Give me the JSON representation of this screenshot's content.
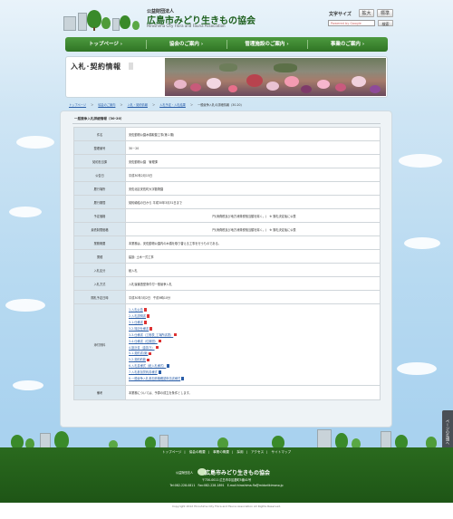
{
  "header": {
    "org_small": "公益財団法人",
    "org_name": "広島市みどり生きもの協会",
    "org_en": "Hiroshima City Flora and Fauna Association",
    "text_size_label": "文字サイズ",
    "text_size_large": "拡大",
    "text_size_standard": "標準",
    "search_placeholder": "Powered by Google",
    "search_button": "検索"
  },
  "nav": {
    "items": [
      {
        "label": "トップページ ›"
      },
      {
        "label": "協会のご案内 ›"
      },
      {
        "label": "管理施設のご案内 ›"
      },
      {
        "label": "事業のご案内 ›"
      }
    ]
  },
  "page": {
    "title": "入札･契約情報"
  },
  "breadcrumb": {
    "items": [
      "トップページ",
      "＞",
      "協会のご案内",
      "＞",
      "入札・契約情報",
      "＞",
      "入札予定・入札結果",
      "＞",
      "一般競争入札の詳細情報（30-20）"
    ]
  },
  "section": {
    "title": "一般競争入札詳細情報（30-20）"
  },
  "spec": {
    "rows": [
      {
        "label": "件名",
        "value": "安佐動物公園木橋取替工事(第１期)"
      },
      {
        "label": "整理番号",
        "value": "30－20"
      },
      {
        "label": "契約担当課",
        "value": "安佐動物公園　管理課"
      },
      {
        "label": "公告日",
        "value": "平成30年2月15日"
      },
      {
        "label": "履行場所",
        "value": "安佐北区安佐町大字動物園"
      },
      {
        "label": "履行期間",
        "value": "契約締結の日から 平成30年3月31日まで"
      },
      {
        "label": "予定価格",
        "value": "円(消費税及び地方消費税相当額を除く。)　※ 落札決定後に公表"
      },
      {
        "label": "最低制限価格",
        "value": "円(消費税及び地方消費税相当額を除く。)　※ 落札決定後に公表"
      },
      {
        "label": "業務概要",
        "value": "本業務は、安佐動物公園内の木橋を取り替える工事を行うものである。"
      },
      {
        "label": "業種",
        "value": "建設: 土木一式工事"
      },
      {
        "label": "入札区分",
        "value": "紙入札"
      },
      {
        "label": "入札方式",
        "value": "入札後審査型条件付一般競争入札"
      },
      {
        "label": "開札予定日時",
        "value": "平成30年3月2日　午前9時10分"
      }
    ],
    "attach_label": "添付資料",
    "attachments": [
      {
        "label": "1.入札公告",
        "icon": "pdf"
      },
      {
        "label": "2.入札説明書",
        "icon": "pdf"
      },
      {
        "label": "3-1.仕様書",
        "icon": "pdf"
      },
      {
        "label": "3-2.特記仕様書",
        "icon": "pdf"
      },
      {
        "label": "3-3.仕様書（工程表_工場所書表）",
        "icon": "pdf"
      },
      {
        "label": "3-4.仕様書（位置図）",
        "icon": "pdf"
      },
      {
        "label": "4.設計書（金抜き）",
        "icon": "pdf"
      },
      {
        "label": "5-1.契約書(案)",
        "icon": "pdf"
      },
      {
        "label": "5-2.契約約款",
        "icon": "pdf"
      },
      {
        "label": "6.入札書様式（紙入札様式）",
        "icon": "doc"
      },
      {
        "label": "7.入札参加誓約書様式",
        "icon": "doc"
      },
      {
        "label": "8.一般競争入札参加資格確認申請書様式",
        "icon": "doc"
      }
    ],
    "remarks_label": "備考",
    "remarks_value": "本業務については、予算の成立を条件とします。"
  },
  "page_top": {
    "label": "ページの先頭へ"
  },
  "footer": {
    "links": [
      "トップページ",
      "協会の概要",
      "事業の概要",
      "採用",
      "アクセス",
      "サイトマップ"
    ],
    "org_small": "公益財団法人",
    "org_name": "広島市みどり生きもの協会",
    "address": "〒730-0011 広島市中区基町5番41号",
    "contact": "Tel:082-228-0811　Fax:082-228-1891　E-mail:hiroshima-flo@midoriikimono.jp",
    "copyright": "Copyright 2012 Hiroshima City Flora and Fauna Association All Rights Reserved."
  },
  "colors": {
    "nav_green": "#2f7424",
    "footer_green": "#1e5516",
    "label_bg": "#d9e6ee",
    "link_blue": "#2a5ea8"
  }
}
